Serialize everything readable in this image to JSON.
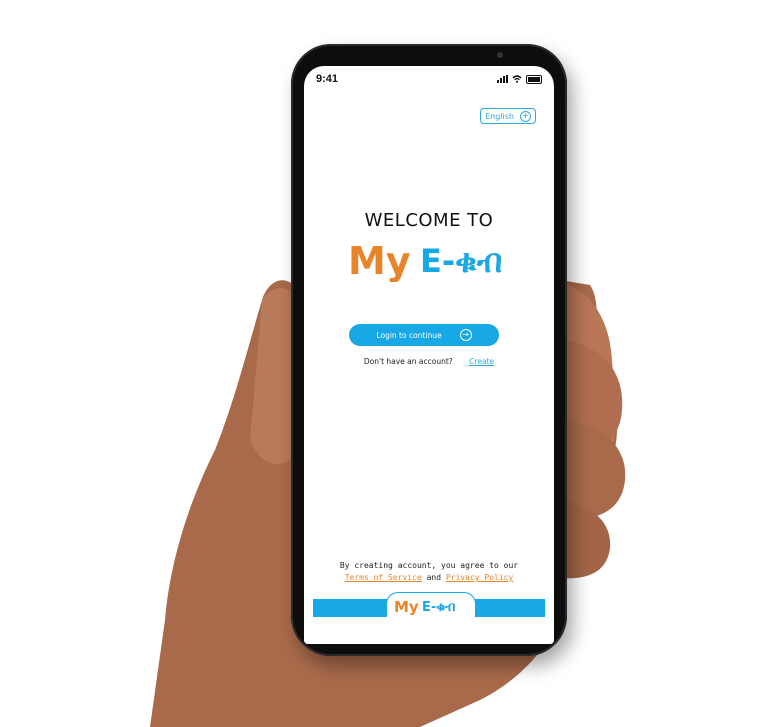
{
  "status_bar": {
    "time": "9:41"
  },
  "language": {
    "label": "English"
  },
  "welcome": {
    "title": "WELCOME TO"
  },
  "logo": {
    "part1": "My",
    "part2": "E-ቁብ"
  },
  "login": {
    "label": "Login to continue"
  },
  "account": {
    "prompt": "Don't have an account?",
    "create_label": "Create"
  },
  "agreement": {
    "text": "By creating account, you agree to our",
    "terms_label": "Terms of Service",
    "and": "and",
    "privacy_label": "Privacy Policy"
  },
  "footer": {
    "logo_part1": "My",
    "logo_part2": "E-ቁብ"
  },
  "colors": {
    "brand_blue": "#18a8e6",
    "brand_orange": "#e8842a"
  }
}
